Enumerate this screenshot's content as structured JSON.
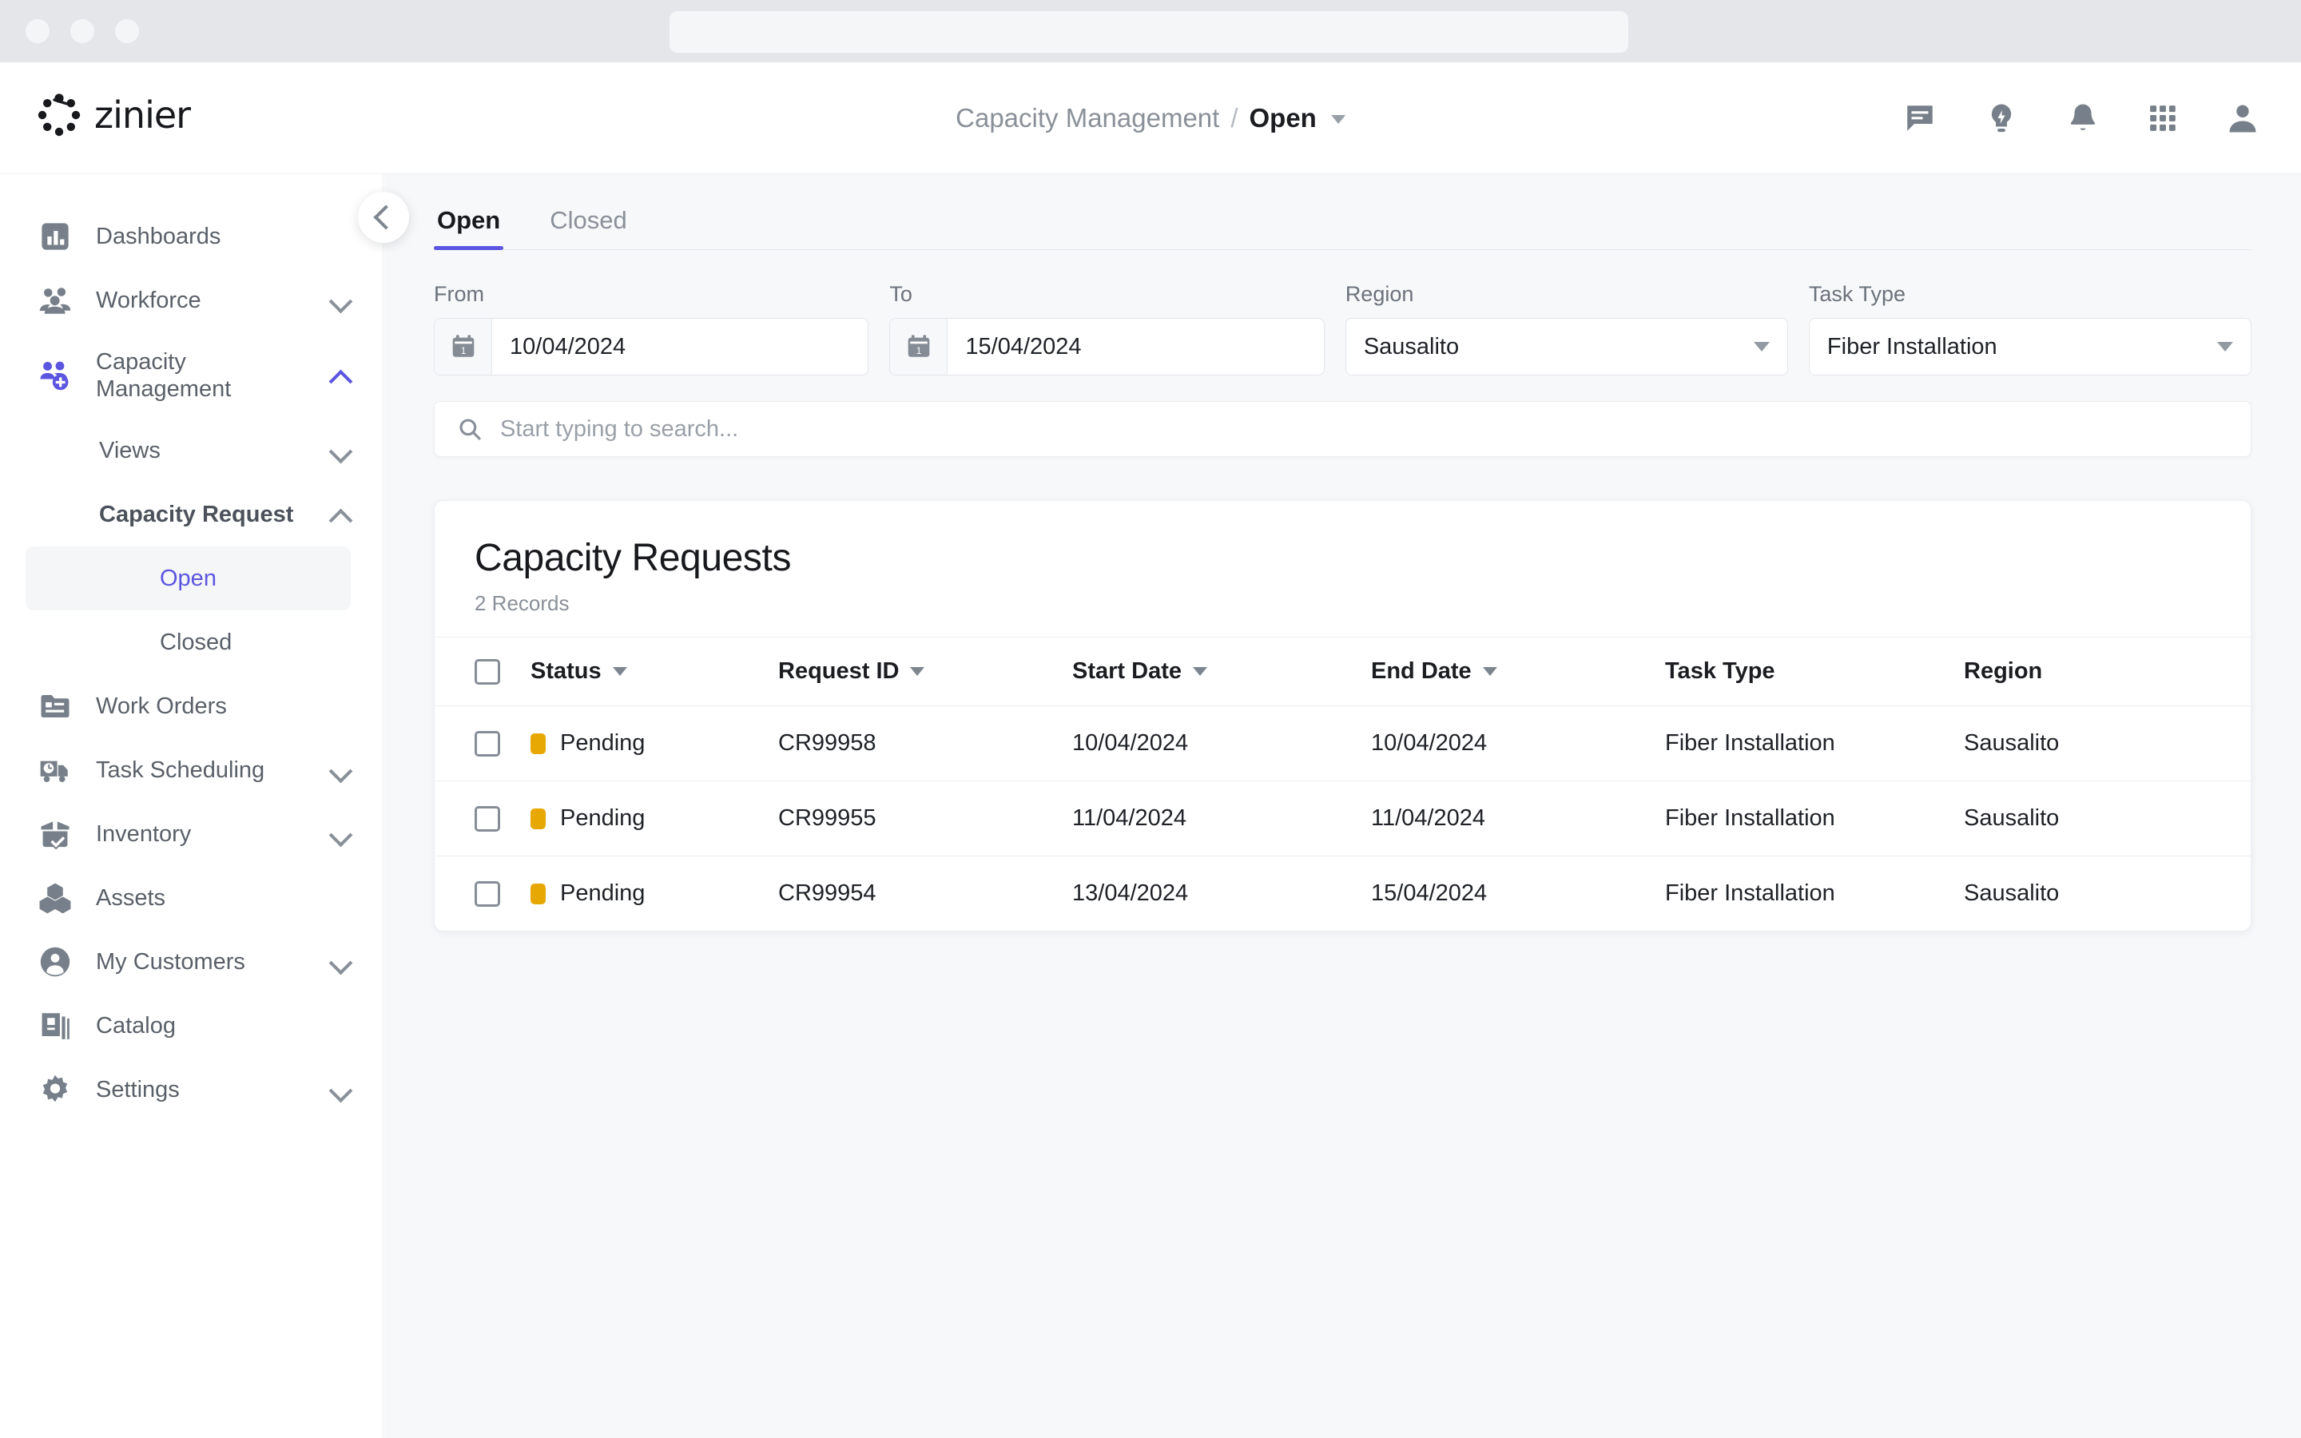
{
  "browser": {
    "window_controls": [
      "close",
      "minimize",
      "maximize"
    ],
    "address_bar_value": ""
  },
  "header": {
    "logo_text": "zinier",
    "breadcrumb": {
      "parent": "Capacity Management",
      "separator": "/",
      "current": "Open",
      "caret_icon": "chevron-down-icon"
    },
    "icons": [
      {
        "name": "messages-icon",
        "glyph": "comment"
      },
      {
        "name": "ideas-icon",
        "glyph": "lightbulb"
      },
      {
        "name": "notifications-icon",
        "glyph": "bell"
      },
      {
        "name": "apps-grid-icon",
        "glyph": "grid"
      },
      {
        "name": "user-profile-icon",
        "glyph": "person"
      }
    ]
  },
  "sidebar": {
    "collapse_button": "collapse-sidebar-button",
    "items": [
      {
        "label": "Dashboards",
        "icon": "dashboard-icon",
        "expandable": false,
        "active": false
      },
      {
        "label": "Workforce",
        "icon": "workforce-icon",
        "expandable": true,
        "expanded": false,
        "active": false
      },
      {
        "label": "Capacity Management",
        "icon": "capacity-management-icon",
        "expandable": true,
        "expanded": true,
        "active": true
      },
      {
        "label": "Work Orders",
        "icon": "work-orders-icon",
        "expandable": false,
        "active": false
      },
      {
        "label": "Task Scheduling",
        "icon": "task-scheduling-icon",
        "expandable": true,
        "expanded": false,
        "active": false
      },
      {
        "label": "Inventory",
        "icon": "inventory-icon",
        "expandable": true,
        "expanded": false,
        "active": false
      },
      {
        "label": "Assets",
        "icon": "assets-icon",
        "expandable": false,
        "active": false
      },
      {
        "label": "My Customers",
        "icon": "my-customers-icon",
        "expandable": true,
        "expanded": false,
        "active": false
      },
      {
        "label": "Catalog",
        "icon": "catalog-icon",
        "expandable": false,
        "active": false
      },
      {
        "label": "Settings",
        "icon": "settings-gear-icon",
        "expandable": true,
        "expanded": false,
        "active": false
      }
    ],
    "sub_items": [
      {
        "label": "Views",
        "expanded": false,
        "bold": false
      },
      {
        "label": "Capacity Request",
        "expanded": true,
        "bold": true
      }
    ],
    "leaf_items": [
      {
        "label": "Open",
        "active": true
      },
      {
        "label": "Closed",
        "active": false
      }
    ]
  },
  "main": {
    "tabs": [
      {
        "label": "Open",
        "active": true
      },
      {
        "label": "Closed",
        "active": false
      }
    ],
    "filters": {
      "from": {
        "label": "From",
        "value": "10/04/2024",
        "icon": "calendar-icon"
      },
      "to": {
        "label": "To",
        "value": "15/04/2024",
        "icon": "calendar-icon"
      },
      "region": {
        "label": "Region",
        "value": "Sausalito",
        "icon": "chevron-down-icon"
      },
      "task_type": {
        "label": "Task Type",
        "value": "Fiber Installation",
        "icon": "chevron-down-icon"
      }
    },
    "search": {
      "placeholder": "Start typing to search...",
      "value": "",
      "icon": "search-icon"
    },
    "card": {
      "title": "Capacity Requests",
      "record_count": "2 Records",
      "columns": [
        {
          "key": "checkbox",
          "label": "",
          "sortable": false
        },
        {
          "key": "status",
          "label": "Status",
          "sortable": true
        },
        {
          "key": "request_id",
          "label": "Request ID",
          "sortable": true
        },
        {
          "key": "start_date",
          "label": "Start Date",
          "sortable": true
        },
        {
          "key": "end_date",
          "label": "End Date",
          "sortable": true
        },
        {
          "key": "task_type",
          "label": "Task Type",
          "sortable": false
        },
        {
          "key": "region",
          "label": "Region",
          "sortable": false
        }
      ],
      "rows": [
        {
          "status": "Pending",
          "request_id": "CR99958",
          "start_date": "10/04/2024",
          "end_date": "10/04/2024",
          "task_type": "Fiber Installation",
          "region": "Sausalito"
        },
        {
          "status": "Pending",
          "request_id": "CR99955",
          "start_date": "11/04/2024",
          "end_date": "11/04/2024",
          "task_type": "Fiber Installation",
          "region": "Sausalito"
        },
        {
          "status": "Pending",
          "request_id": "CR99954",
          "start_date": "13/04/2024",
          "end_date": "15/04/2024",
          "task_type": "Fiber Installation",
          "region": "Sausalito"
        }
      ]
    }
  },
  "colors": {
    "accent": "#5b55e0",
    "status_pending": "#e8a803",
    "text_primary": "#1b1d21",
    "text_muted": "#8a9099",
    "bg_canvas": "#f7f8fa",
    "browser_chrome": "#e4e6e9"
  }
}
